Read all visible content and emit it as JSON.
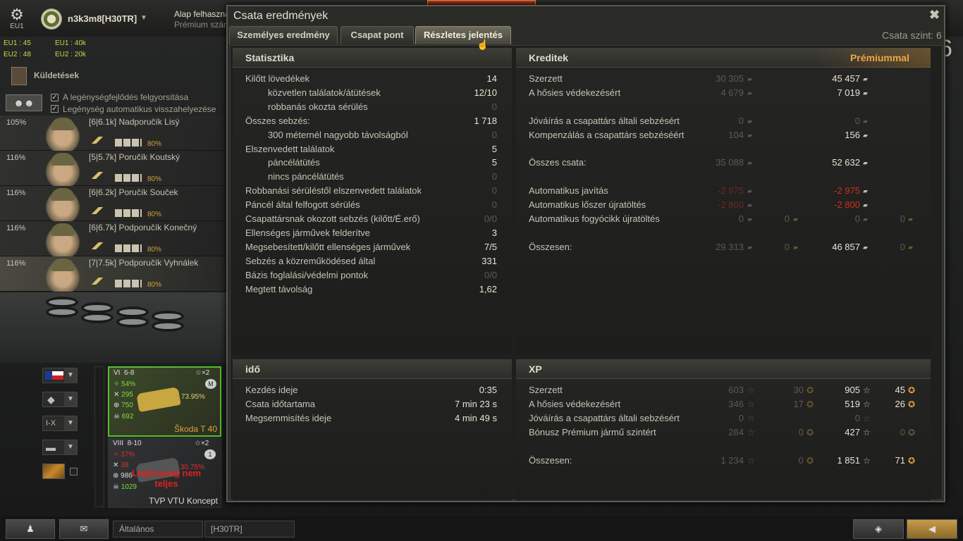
{
  "top": {
    "server_label": "EU1",
    "player_name": "n3k3m8[H30TR]",
    "account_line1": "Alap felhaszná",
    "account_line2": "Prémium szám",
    "servers": [
      "EU1 : 45",
      "EU1 : 40k",
      "EU2 : 48",
      "EU2 : 20k"
    ]
  },
  "left": {
    "missions_label": "Küldetések",
    "checkboxes": [
      "A legénységfejlődés felgyorsítása",
      "Legénység automatikus visszahelyezése"
    ],
    "crew": [
      {
        "pct": "105%",
        "name": "[6|6.1k] Nadporučík Lisý",
        "skill": "80%"
      },
      {
        "pct": "116%",
        "name": "[5|5.7k] Poručík Koutský",
        "skill": "80%"
      },
      {
        "pct": "116%",
        "name": "[6|6.2k] Poručík Souček",
        "skill": "80%"
      },
      {
        "pct": "116%",
        "name": "[6|6.7k] Podporučík Konečný",
        "skill": "80%"
      },
      {
        "pct": "116%",
        "name": "[7|7.5k] Podporučík Vyhnálek",
        "skill": "80%"
      }
    ],
    "filter_tier": "I-X",
    "tanks": [
      {
        "tier": "VI",
        "range": "6-8",
        "mult": "×2",
        "winrate": "54%",
        "dmg": "295",
        "spot": "750",
        "kills": "692",
        "mastery_pct": "73.95%",
        "name": "Škoda T 40",
        "badge": "M"
      },
      {
        "tier": "VIII",
        "range": "8-10",
        "mult": "×2",
        "winrate": "37%",
        "dmg": "38",
        "spot": "986",
        "kills": "1029",
        "mastery_pct": "30.75%",
        "name": "TVP VTU Koncept",
        "badge": "1",
        "warning": "Legénység nem teljes"
      }
    ]
  },
  "bottom": {
    "chat_general": "Általános",
    "chat_clan": "[H30TR]"
  },
  "dialog": {
    "title": "Csata eredmények",
    "close": "✖",
    "tabs": [
      "Személyes eredmény",
      "Csapat pont",
      "Részletes jelentés"
    ],
    "active_tab": 2,
    "battle_level": "Csata szint: 6",
    "stats": {
      "header": "Statisztika",
      "rows": [
        {
          "label": "Kilőtt lövedékek",
          "value": "14",
          "indent": false,
          "dim": false
        },
        {
          "label": "közvetlen találatok/átütések",
          "value": "12/10",
          "indent": true,
          "dim": false
        },
        {
          "label": "robbanás okozta sérülés",
          "value": "0",
          "indent": true,
          "dim": true
        },
        {
          "label": "Összes sebzés:",
          "value": "1 718",
          "indent": false,
          "dim": false
        },
        {
          "label": "300 méternél nagyobb távolságból",
          "value": "0",
          "indent": true,
          "dim": true
        },
        {
          "label": "Elszenvedett találatok",
          "value": "5",
          "indent": false,
          "dim": false
        },
        {
          "label": "páncélátütés",
          "value": "5",
          "indent": true,
          "dim": false
        },
        {
          "label": "nincs páncélátütés",
          "value": "0",
          "indent": true,
          "dim": true
        },
        {
          "label": "Robbanási sérüléstől elszenvedett találatok",
          "value": "0",
          "indent": false,
          "dim": true
        },
        {
          "label": "Páncél által felfogott sérülés",
          "value": "0",
          "indent": false,
          "dim": true
        },
        {
          "label": "Csapattársnak okozott sebzés (kilőtt/É.erő)",
          "value": "0/0",
          "indent": false,
          "dim": true
        },
        {
          "label": "Ellenséges járművek felderítve",
          "value": "3",
          "indent": false,
          "dim": false
        },
        {
          "label": "Megsebesített/kilőtt ellenséges járművek",
          "value": "7/5",
          "indent": false,
          "dim": false
        },
        {
          "label": "Sebzés a közreműködésed által",
          "value": "331",
          "indent": false,
          "dim": false
        },
        {
          "label": "Bázis foglalási/védelmi pontok",
          "value": "0/0",
          "indent": false,
          "dim": true
        },
        {
          "label": "Megtett távolság",
          "value": "1,62",
          "indent": false,
          "dim": false
        }
      ]
    },
    "credits": {
      "header": "Kreditek",
      "premium_header": "Prémiummal",
      "rows": [
        {
          "label": "Szerzett",
          "base": "30 305",
          "prem": "45 457"
        },
        {
          "label": "A hősies védekezésért",
          "base": "4 679",
          "prem": "7 019"
        },
        {
          "label": "",
          "base": "",
          "prem": ""
        },
        {
          "label": "Jóváírás a csapattárs általi sebzésért",
          "base": "0",
          "prem": "0",
          "dim": true
        },
        {
          "label": "Kompenzálás a csapattárs sebzéséért",
          "base": "104",
          "prem": "156"
        },
        {
          "label": "",
          "base": "",
          "prem": ""
        },
        {
          "label": "Összes csata:",
          "base": "35 088",
          "prem": "52 632"
        },
        {
          "label": "",
          "base": "",
          "prem": ""
        },
        {
          "label": "Automatikus javítás",
          "base": "-2 975",
          "prem": "-2 975",
          "neg": true
        },
        {
          "label": "Automatikus lőszer újratöltés",
          "base": "-2 800",
          "prem": "-2 800",
          "neg": true
        },
        {
          "label": "Automatikus fogyócikk újratöltés",
          "base": "0",
          "base_gold": "0",
          "prem": "0",
          "prem_gold": "0",
          "dim": true
        },
        {
          "label": "",
          "base": "",
          "prem": ""
        },
        {
          "label": "Összesen:",
          "base": "29 313",
          "base_gold": "0",
          "prem": "46 857",
          "prem_gold": "0"
        }
      ]
    },
    "time": {
      "header": "idő",
      "rows": [
        {
          "label": "Kezdés ideje",
          "value": "0:35"
        },
        {
          "label": "Csata időtartama",
          "value": "7 min 23 s"
        },
        {
          "label": "Megsemmisítés ideje",
          "value": "4 min 49 s"
        }
      ]
    },
    "xp": {
      "header": "XP",
      "rows": [
        {
          "label": "Szerzett",
          "base": "603",
          "base_free": "30",
          "prem": "905",
          "prem_free": "45"
        },
        {
          "label": "A hősies védekezésért",
          "base": "346",
          "base_free": "17",
          "prem": "519",
          "prem_free": "26"
        },
        {
          "label": "Jóváírás a csapattárs általi sebzésért",
          "base": "0",
          "base_free": "",
          "prem": "0",
          "prem_free": "",
          "dim": true
        },
        {
          "label": "Bónusz Prémium jármű szintért",
          "base": "284",
          "base_free": "0",
          "prem": "427",
          "prem_free": "0"
        },
        {
          "label": "",
          "base": "",
          "base_free": "",
          "prem": "",
          "prem_free": ""
        },
        {
          "label": "Összesen:",
          "base": "1 234",
          "base_free": "0",
          "prem": "1 851",
          "prem_free": "71"
        }
      ]
    }
  },
  "right_edge_number": "6"
}
